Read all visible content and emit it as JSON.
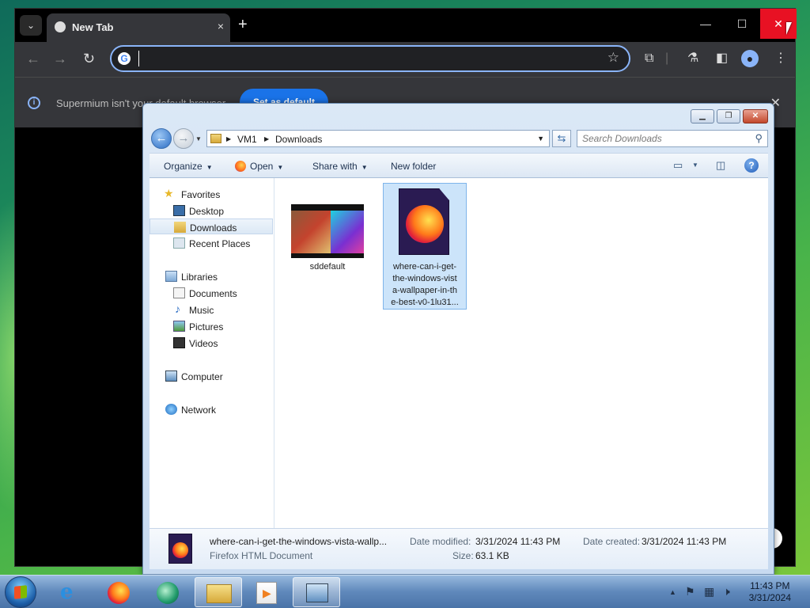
{
  "browser": {
    "tab": {
      "title": "New Tab",
      "close": "×"
    },
    "new_tab": "+",
    "window_controls": {
      "minimize": "—",
      "maximize": "☐",
      "close": "✕"
    },
    "omnibox": {
      "value": "",
      "placeholder": ""
    },
    "infobar": {
      "message": "Supermium isn't your default browser",
      "button": "Set as default",
      "close": "✕"
    }
  },
  "explorer": {
    "caption": {
      "minimize": "▁",
      "maximize": "❐",
      "close": "✕"
    },
    "address": {
      "crumbs": [
        "VM1",
        "Downloads"
      ]
    },
    "search": {
      "placeholder": "Search Downloads"
    },
    "commands": {
      "organize": "Organize",
      "open": "Open",
      "share_with": "Share with",
      "new_folder": "New folder"
    },
    "nav": {
      "favorites": {
        "label": "Favorites",
        "items": [
          "Desktop",
          "Downloads",
          "Recent Places"
        ]
      },
      "libraries": {
        "label": "Libraries",
        "items": [
          "Documents",
          "Music",
          "Pictures",
          "Videos"
        ]
      },
      "computer": "Computer",
      "network": "Network"
    },
    "files": [
      {
        "name": "sddefault"
      },
      {
        "name_lines": [
          "where-can-i-get-",
          "the-windows-vist",
          "a-wallpaper-in-th",
          "e-best-v0-1lu31..."
        ]
      }
    ],
    "details": {
      "name": "where-can-i-get-the-windows-vista-wallp...",
      "type": "Firefox HTML Document",
      "date_modified_label": "Date modified:",
      "date_modified": "3/31/2024 11:43 PM",
      "size_label": "Size:",
      "size": "63.1 KB",
      "date_created_label": "Date created:",
      "date_created": "3/31/2024 11:43 PM"
    }
  },
  "taskbar": {
    "clock_time": "11:43 PM",
    "clock_date": "3/31/2024"
  },
  "colors": {
    "chrome_dark": "#35363a",
    "accent_blue": "#1a73e8",
    "close_red": "#e81123"
  }
}
